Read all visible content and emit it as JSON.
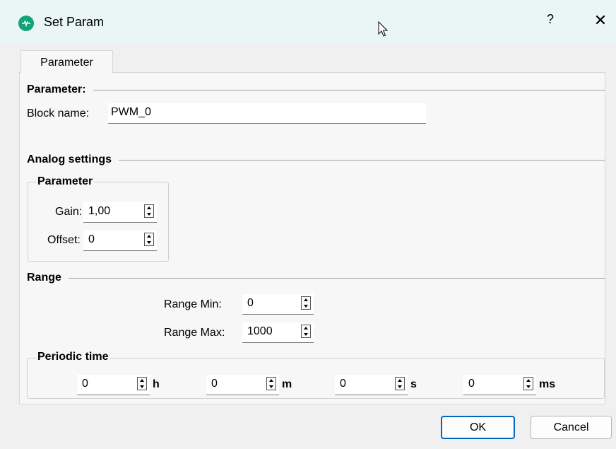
{
  "window": {
    "title": "Set Param",
    "help_label": "?",
    "close_label": "✕",
    "icon": "app-logo-icon",
    "accent": "#12a37a"
  },
  "tabs": [
    {
      "label": "Parameter"
    }
  ],
  "parameter_section": {
    "title": "Parameter:",
    "block_name_label": "Block name:",
    "block_name_value": "PWM_0"
  },
  "analog_settings": {
    "title": "Analog settings",
    "group_title": "Parameter",
    "gain_label": "Gain:",
    "gain_value": "1,00",
    "offset_label": "Offset:",
    "offset_value": "0"
  },
  "range": {
    "title": "Range",
    "min_label": "Range Min:",
    "min_value": "0",
    "max_label": "Range Max:",
    "max_value": "1000"
  },
  "periodic_time": {
    "title": "Periodic time",
    "fields": [
      {
        "value": "0",
        "unit": "h"
      },
      {
        "value": "0",
        "unit": "m"
      },
      {
        "value": "0",
        "unit": "s"
      },
      {
        "value": "0",
        "unit": "ms"
      }
    ]
  },
  "buttons": {
    "ok": "OK",
    "cancel": "Cancel"
  }
}
